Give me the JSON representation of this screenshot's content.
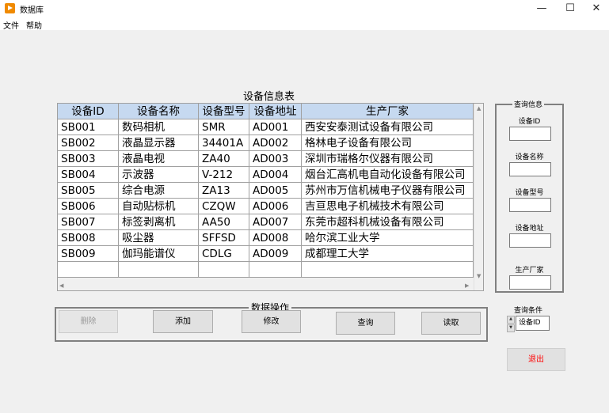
{
  "window": {
    "title": "数据库",
    "minimize": "—",
    "maximize": "☐",
    "close": "✕"
  },
  "menu": [
    "文件",
    "帮助"
  ],
  "table": {
    "title": "设备信息表",
    "columns": [
      "设备ID",
      "设备名称",
      "设备型号",
      "设备地址",
      "生产厂家"
    ],
    "rows": [
      [
        "SB001",
        "数码相机",
        "SMR",
        "AD001",
        "西安安泰测试设备有限公司"
      ],
      [
        "SB002",
        "液晶显示器",
        "34401A",
        "AD002",
        "格林电子设备有限公司"
      ],
      [
        "SB003",
        "液晶电视",
        "ZA40",
        "AD003",
        "深圳市瑞格尔仪器有限公司"
      ],
      [
        "SB004",
        "示波器",
        "V-212",
        "AD004",
        "烟台汇高机电自动化设备有限公司"
      ],
      [
        "SB005",
        "综合电源",
        "ZA13",
        "AD005",
        "苏州市万信机械电子仪器有限公司"
      ],
      [
        "SB006",
        "自动贴标机",
        "CZQW",
        "AD006",
        "吉亘思电子机械技术有限公司"
      ],
      [
        "SB007",
        "标签剥离机",
        "AA50",
        "AD007",
        "东莞市超科机械设备有限公司"
      ],
      [
        "SB008",
        "吸尘器",
        "SFFSD",
        "AD008",
        "哈尔滨工业大学"
      ],
      [
        "SB009",
        "伽玛能谱仪",
        "CDLG",
        "AD009",
        "成都理工大学"
      ],
      [
        "",
        "",
        "",
        "",
        ""
      ]
    ]
  },
  "operations": {
    "legend": "数据操作",
    "buttons": {
      "delete": "删除",
      "add": "添加",
      "modify": "修改",
      "query": "查询",
      "read": "读取"
    }
  },
  "query_panel": {
    "legend": "查询信息",
    "fields": [
      {
        "label": "设备ID",
        "value": ""
      },
      {
        "label": "设备名称",
        "value": ""
      },
      {
        "label": "设备型号",
        "value": ""
      },
      {
        "label": "设备地址",
        "value": ""
      },
      {
        "label": "生产厂家",
        "value": ""
      }
    ]
  },
  "condition": {
    "label": "查询条件",
    "value": "设备ID"
  },
  "exit": {
    "label": "退出",
    "color": "#ff0000"
  },
  "colors": {
    "header_bg": "#c6d9f0",
    "window_bg": "#f0f0f0"
  }
}
